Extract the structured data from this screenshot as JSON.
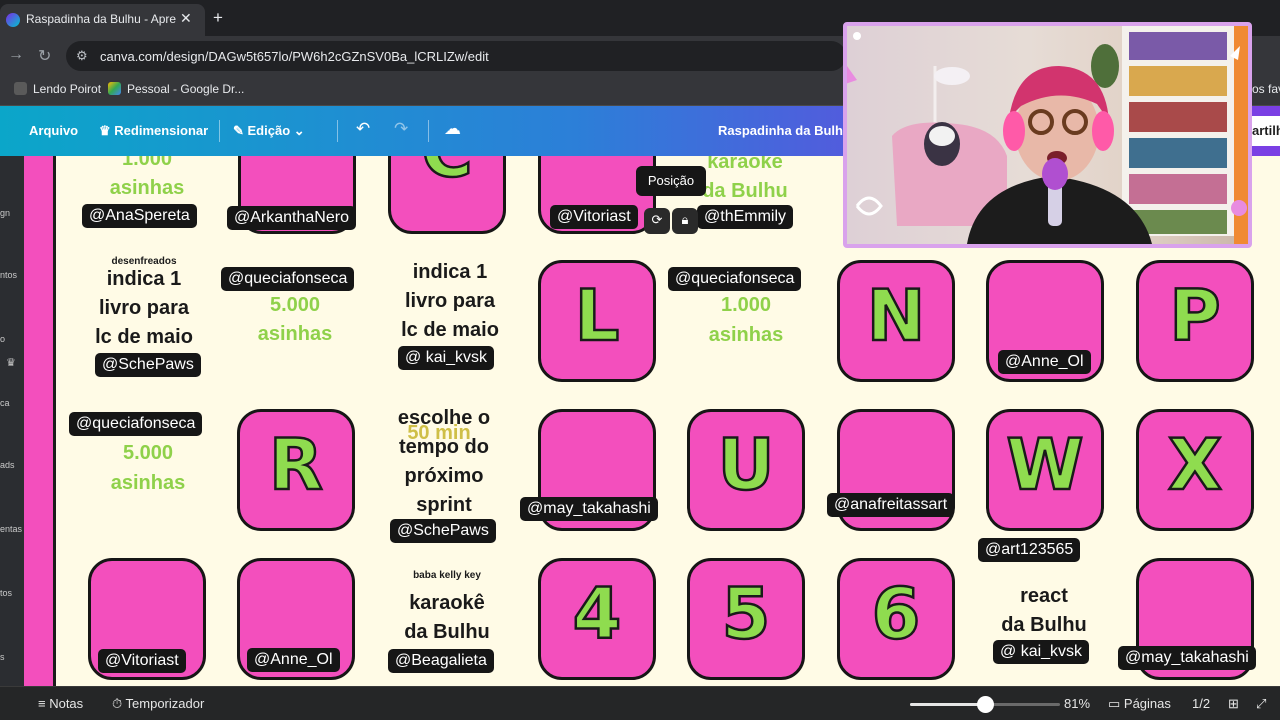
{
  "browser": {
    "tab_title": "Raspadinha da Bulhu - Apresen",
    "url": "canva.com/design/DAGw5t657lo/PW6h2cGZnSV0Ba_lCRLIZw/edit",
    "bookmarks": [
      "Lendo Poirot",
      "Pessoal - Google Dr...",
      "os fave"
    ]
  },
  "toolbar": {
    "file": "Arquivo",
    "resize": "Redimensionar",
    "edit": "Edição",
    "design_title": "Raspadinha da Bulhu",
    "share": "artilh"
  },
  "sidepanel": [
    "gn",
    "ntos",
    "o",
    "ca",
    "ads",
    "entas",
    "tos",
    "s"
  ],
  "canvas": {
    "tooltip": "Posição",
    "letters": [
      "C",
      "L",
      "N",
      "P",
      "R",
      "U",
      "W",
      "X",
      "4",
      "5",
      "6"
    ],
    "texts": {
      "r1c1_amount": "1.000",
      "r1c1_unit": "asinhas",
      "r1c6_line1": "karaokê",
      "r1c6_line2": "da Bulhu",
      "r2c1_small": "desenfreados",
      "r2c1_line1": "indica 1",
      "r2c1_line2": "livro para",
      "r2c1_line3": "lc de maio",
      "r2c2_amount": "5.000",
      "r2c2_unit": "asinhas",
      "r2c3_line1": "indica 1",
      "r2c3_line2": "livro para",
      "r2c3_line3": "lc de maio",
      "r2c5_amount": "1.000",
      "r2c5_unit": "asinhas",
      "r3c1_amount": "5.000",
      "r3c1_unit": "asinhas",
      "r3c3_line1": "escolhe o",
      "r3c3_line2": "tempo do",
      "r3c3_line3": "próximo",
      "r3c3_line4": "sprint",
      "r3c3_overlap": "50 min",
      "r4c3_small": "baba kelly key",
      "r4c3_line1": "karaokê",
      "r4c3_line2": "da Bulhu",
      "r4c7_line1": "react",
      "r4c7_line2": "da Bulhu"
    },
    "tags": {
      "anaspereta": "@AnaSpereta",
      "arkanthanero": "@ArkanthaNero",
      "vitoriast_top": "@Vitoriast",
      "themmily": "@thEmmily",
      "queciafonseca_r2": "@queciafonseca",
      "queciafonseca_r2b": "@queciafonseca",
      "schepaws_r2": "@SchePaws",
      "kai_kvsk_r2": "@ kai_kvsk",
      "anne_ol_r2": "@Anne_Ol",
      "queciafonseca_r3": "@queciafonseca",
      "may_takahashi_r3": "@may_takahashi",
      "anafreitassart": "@anafreitassart",
      "art123565": "@art123565",
      "schepaws_r3": "@SchePaws",
      "vitoriast_r4": "@Vitoriast",
      "anne_ol_r4": "@Anne_Ol",
      "beagalieta": "@Beagalieta",
      "kai_kvsk_r4": "@ kai_kvsk",
      "may_takahashi_r4": "@may_takahashi"
    }
  },
  "statusbar": {
    "notes": "Notas",
    "timer": "Temporizador",
    "zoom": "81%",
    "zoom_value": 0.5,
    "pages_label": "Páginas",
    "pages": "1/2"
  },
  "colors": {
    "card_pink": "#f34fbd",
    "letter_green": "#8fdc4f",
    "cream": "#fffbe6",
    "toolbar_gradient_start": "#0ba6c9",
    "toolbar_gradient_end": "#7b3fe4"
  }
}
